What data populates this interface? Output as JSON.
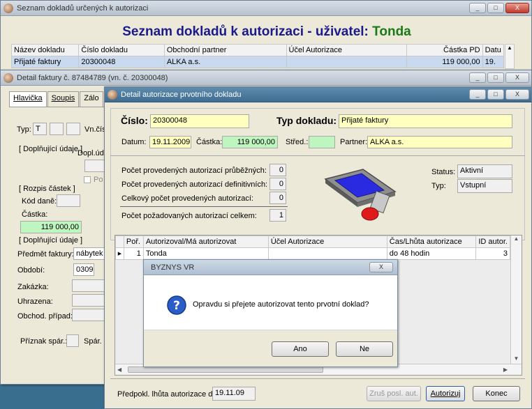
{
  "list_window": {
    "title": "Seznam dokladů určených k autorizaci",
    "heading_prefix": "Seznam dokladů k autorizaci - uživatel:",
    "heading_user": "Tonda",
    "columns": [
      "Název dokladu",
      "Číslo dokladu",
      "Obchodní partner",
      "Účel Autorizace",
      "Částka PD",
      "Datu"
    ],
    "row": [
      "Přijaté faktury",
      "20300048",
      "ALKA a.s.",
      "",
      "119 000,00",
      "19."
    ],
    "controls": [
      "_",
      "□",
      "X"
    ]
  },
  "invoice_window": {
    "title": "Detail faktury č. 87484789 (vn. č. 20300048)",
    "tabs": [
      "Hlavička",
      "Soupis",
      "Zálo"
    ],
    "typ_label": "Typ:",
    "typ_value": "T",
    "vncis_label": "Vn.čís",
    "group1": "[ Doplňující údaje ]",
    "dopl_label": "Dopl.úda",
    "po_label": "Po",
    "group2": "[ Rozpis částek ]",
    "kod_dane_label": "Kód daně:",
    "castka_label": "Částka:",
    "castka_value": "119 000,00",
    "group3": "[ Doplňující údaje ]",
    "predmet_label": "Předmět faktury:",
    "predmet_value": "nábytek",
    "obdobi_label": "Období:",
    "obdobi_value": "0309",
    "zakazka_label": "Zakázka:",
    "uhrazena_label": "Uhrazena:",
    "obchod_label": "Obchod. případ:",
    "priznak_label": "Příznak spár.:",
    "spar_label": "Spár. s",
    "controls": [
      "_",
      "□",
      "X"
    ]
  },
  "auth_window": {
    "title": "Detail autorizace prvotního dokladu",
    "cislo_label": "Číslo:",
    "cislo_value": "20300048",
    "typ_label": "Typ dokladu:",
    "typ_value": "Přijaté faktury",
    "datum_label": "Datum:",
    "datum_value": "19.11.2009",
    "castka_label": "Částka:",
    "castka_value": "119 000,00",
    "stred_label": "Střed.:",
    "stred_value": "",
    "partner_label": "Partner:",
    "partner_value": "ALKA a.s.",
    "counts": [
      {
        "label": "Počet provedených autorizací průběžných:",
        "value": "0"
      },
      {
        "label": "Počet provedených autorizací definitivních:",
        "value": "0"
      },
      {
        "label": "Celkový počet provedených autorizací:",
        "value": "0"
      }
    ],
    "required_label": "Počet požadovaných autorizací celkem:",
    "required_value": "1",
    "status_label": "Status:",
    "status_value": "Aktivní",
    "typ2_label": "Typ:",
    "typ2_value": "Vstupní",
    "grid_columns": [
      "Poř.",
      "Autorizoval/Má autorizovat",
      "Účel Autorizace",
      "Čas/Lhůta autorizace",
      "ID autor."
    ],
    "grid_row": [
      "1",
      "Tonda",
      "",
      "do 48 hodin",
      "3"
    ],
    "deadline_label": "Předpokl. lhůta autorizace do:",
    "deadline_value": "19.11.09",
    "btn_undo": "Zruš posl. aut.",
    "btn_authorize": "Autorizuj",
    "btn_close": "Konec",
    "controls": [
      "_",
      "□",
      "X"
    ]
  },
  "dialog": {
    "title": "BYZNYS VR",
    "icon": "question-icon",
    "message": "Opravdu si přejete autorizovat tento prvotní doklad?",
    "btn_yes": "Ano",
    "btn_no": "Ne",
    "close": "X"
  },
  "colors": {
    "heading_blue": "#1a1a8c",
    "heading_green": "#1a7a1a",
    "field_yellow": "#ffffc0",
    "field_green": "#bff5bf"
  }
}
